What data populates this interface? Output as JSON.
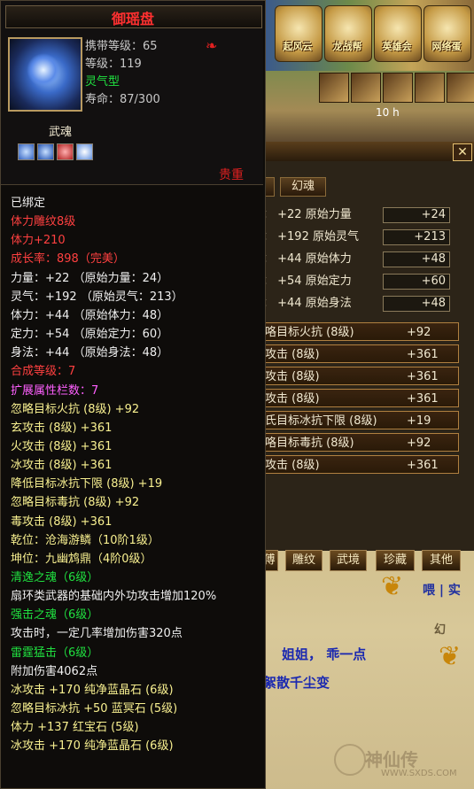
{
  "tooltip": {
    "title": "御瑶盘",
    "info": [
      {
        "text": "携带等级：65",
        "color": "#c8c8c8"
      },
      {
        "text": "等级：119",
        "color": "#c8c8c8"
      },
      {
        "text": "灵气型",
        "color": "#20e040"
      },
      {
        "text": "寿命：87/300",
        "color": "#c8c8c8"
      }
    ],
    "wuhun_label": "武魂",
    "rarity": "贵重",
    "lines": [
      {
        "text": "已绑定",
        "color": "c-white"
      },
      {
        "text": "体力雕纹8级",
        "color": "c-red"
      },
      {
        "text": "体力+210",
        "color": "c-red"
      },
      {
        "text": "成长率：898（完美）",
        "color": "c-red"
      },
      {
        "text": "力量：+22 （原始力量：24）",
        "color": "c-white"
      },
      {
        "text": "灵气：+192 （原始灵气：213）",
        "color": "c-white"
      },
      {
        "text": "体力：+44 （原始体力：48）",
        "color": "c-white"
      },
      {
        "text": "定力：+54 （原始定力：60）",
        "color": "c-white"
      },
      {
        "text": "身法：+44 （原始身法：48）",
        "color": "c-white"
      },
      {
        "text": "合成等级：7",
        "color": "c-red"
      },
      {
        "text": "扩展属性栏数：7",
        "color": "c-pink"
      },
      {
        "text": "忽略目标火抗 (8级) +92",
        "color": "c-yellow"
      },
      {
        "text": "玄攻击 (8级) +361",
        "color": "c-yellow"
      },
      {
        "text": "火攻击 (8级) +361",
        "color": "c-yellow"
      },
      {
        "text": "冰攻击 (8级) +361",
        "color": "c-yellow"
      },
      {
        "text": "降低目标冰抗下限 (8级) +19",
        "color": "c-yellow"
      },
      {
        "text": "忽略目标毒抗 (8级) +92",
        "color": "c-yellow"
      },
      {
        "text": "毒攻击 (8级) +361",
        "color": "c-yellow"
      },
      {
        "text": "乾位：沧海游鳞（10阶1级）",
        "color": "c-yellow"
      },
      {
        "text": "坤位：九幽鸩鼎（4阶0级）",
        "color": "c-yellow"
      },
      {
        "text": "清逸之魂（6级）",
        "color": "c-green"
      },
      {
        "text": "扇环类武器的基础内外功攻击增加120%",
        "color": "c-white"
      },
      {
        "text": "强击之魂（6级）",
        "color": "c-green"
      },
      {
        "text": "攻击时，一定几率增加伤害320点",
        "color": "c-white"
      },
      {
        "text": "雷霆猛击（6级）",
        "color": "c-green"
      },
      {
        "text": "附加伤害4062点",
        "color": "c-white"
      },
      {
        "text": "冰攻击 +170 纯净蓝晶石 (6级)",
        "color": "c-yellow"
      },
      {
        "text": "忽略目标冰抗 +50 蓝冥石 (5级)",
        "color": "c-yellow"
      },
      {
        "text": "体力 +137 红宝石 (5级)",
        "color": "c-yellow"
      },
      {
        "text": "冰攻击 +170 纯净蓝晶石 (6级)",
        "color": "c-yellow"
      }
    ]
  },
  "banner": {
    "items": [
      "起风云",
      "龙战帮",
      "英雄会",
      "网络蛋"
    ]
  },
  "timer": "10 h",
  "right_panel": {
    "tab": "幻魂",
    "stats": [
      {
        "label": "：  +22  原始力量",
        "value": "+24"
      },
      {
        "label": "：  +192 原始灵气",
        "value": "+213"
      },
      {
        "label": "：  +44  原始体力",
        "value": "+48"
      },
      {
        "label": "：  +54  原始定力",
        "value": "+60"
      },
      {
        "label": "：  +44  原始身法",
        "value": "+48"
      }
    ],
    "attrs": [
      {
        "label": "咯目标火抗 (8级)",
        "value": "+92"
      },
      {
        "label": "攻击 (8级)",
        "value": "+361"
      },
      {
        "label": "攻击 (8级)",
        "value": "+361"
      },
      {
        "label": "攻击 (8级)",
        "value": "+361"
      },
      {
        "label": "氏目标冰抗下限 (8级)",
        "value": "+19"
      },
      {
        "label": "咯目标毒抗 (8级)",
        "value": "+92"
      },
      {
        "label": "攻击 (8级)",
        "value": "+361"
      }
    ],
    "bottom_tabs": [
      "傅",
      "雕纹",
      "武境",
      "珍藏",
      "其他"
    ]
  },
  "chat": {
    "line1": "喂 | 实",
    "line2": "姐姐， 乖一点",
    "line3": "絮散千尘变",
    "faint": "幻"
  },
  "watermark": {
    "text": "神仙传",
    "url": "WWW.SXDS.COM"
  }
}
